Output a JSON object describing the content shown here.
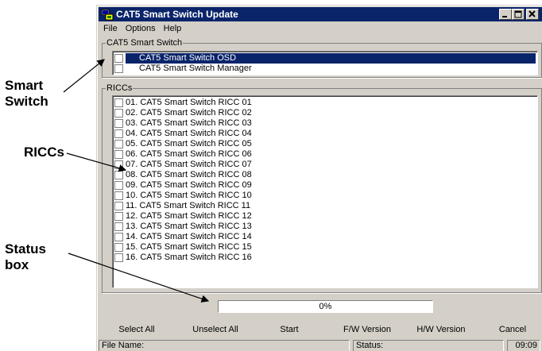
{
  "callouts": {
    "smart_switch": [
      "Smart",
      "Switch"
    ],
    "riccs": "RICCs",
    "status_box": [
      "Status",
      "box"
    ]
  },
  "window": {
    "title": "CAT5 Smart Switch Update",
    "controls": [
      "_",
      "□",
      "×"
    ]
  },
  "menu": {
    "file": "File",
    "options": "Options",
    "help": "Help"
  },
  "smart_switch_group": {
    "label": "CAT5 Smart Switch",
    "items": [
      {
        "label": "CAT5 Smart Switch OSD",
        "checked": false,
        "selected": true
      },
      {
        "label": "CAT5 Smart Switch Manager",
        "checked": false,
        "selected": false
      }
    ]
  },
  "riccs_group": {
    "label": "RICCs",
    "items": [
      {
        "label": "01. CAT5 Smart Switch RICC 01",
        "checked": false
      },
      {
        "label": "02. CAT5 Smart Switch RICC 02",
        "checked": false
      },
      {
        "label": "03. CAT5 Smart Switch RICC 03",
        "checked": false
      },
      {
        "label": "04. CAT5 Smart Switch RICC 04",
        "checked": false
      },
      {
        "label": "05. CAT5 Smart Switch RICC 05",
        "checked": false
      },
      {
        "label": "06. CAT5 Smart Switch RICC 06",
        "checked": false
      },
      {
        "label": "07. CAT5 Smart Switch RICC 07",
        "checked": false
      },
      {
        "label": "08. CAT5 Smart Switch RICC 08",
        "checked": false
      },
      {
        "label": "09. CAT5 Smart Switch RICC 09",
        "checked": false
      },
      {
        "label": "10. CAT5 Smart Switch RICC 10",
        "checked": false
      },
      {
        "label": "11. CAT5 Smart Switch RICC 11",
        "checked": false
      },
      {
        "label": "12. CAT5 Smart Switch RICC 12",
        "checked": false
      },
      {
        "label": "13. CAT5 Smart Switch RICC 13",
        "checked": false
      },
      {
        "label": "14. CAT5 Smart Switch RICC 14",
        "checked": false
      },
      {
        "label": "15. CAT5 Smart Switch RICC 15",
        "checked": false
      },
      {
        "label": "16. CAT5 Smart Switch RICC 16",
        "checked": false
      }
    ]
  },
  "progress": {
    "percent_text": "0%",
    "value": 0
  },
  "buttons": {
    "select_all": "Select All",
    "unselect_all": "Unselect All",
    "start": "Start",
    "fw_version": "F/W Version",
    "hw_version": "H/W Version",
    "cancel": "Cancel"
  },
  "statusbar": {
    "file_name": "File Name:",
    "status": "Status:",
    "time": "09:09"
  },
  "colors": {
    "titlebar": "#0a246a",
    "face": "#d4d0c8",
    "selection": "#0a246a"
  }
}
